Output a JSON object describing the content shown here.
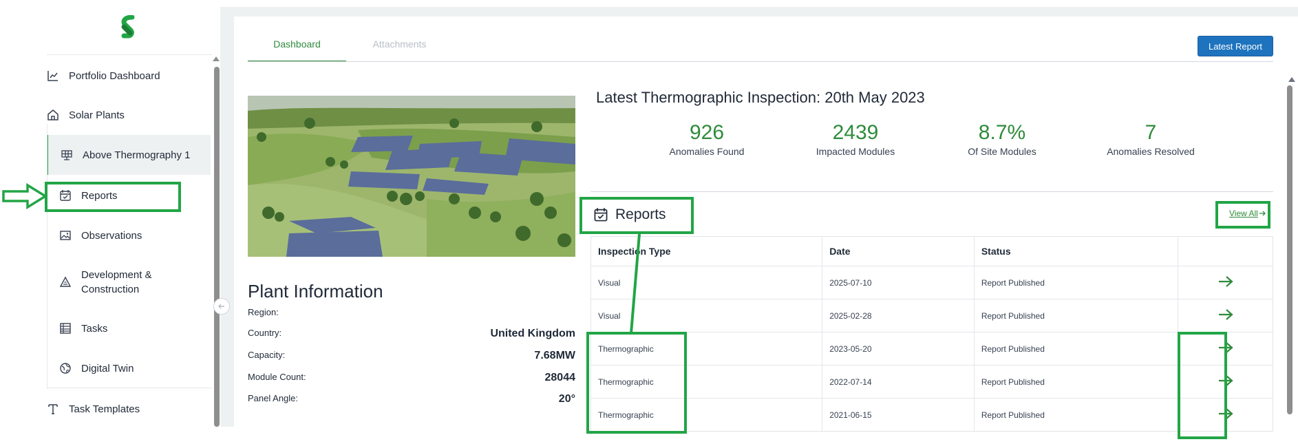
{
  "sidebar": {
    "items": [
      {
        "label": "Portfolio Dashboard",
        "icon": "chart-line-icon"
      },
      {
        "label": "Solar Plants",
        "icon": "home-icon"
      },
      {
        "label": "Above Thermography 1",
        "icon": "solar-panel-icon"
      },
      {
        "label": "Reports",
        "icon": "calendar-check-icon"
      },
      {
        "label": "Observations",
        "icon": "image-icon"
      },
      {
        "label": "Development & Construction",
        "icon": "construction-icon"
      },
      {
        "label": "Tasks",
        "icon": "table-icon"
      },
      {
        "label": "Digital Twin",
        "icon": "globe-icon"
      },
      {
        "label": "Task Templates",
        "icon": "template-icon"
      }
    ]
  },
  "tabs": [
    "Dashboard",
    "Attachments"
  ],
  "latest_report_label": "Latest Report",
  "inspection": {
    "title": "Latest Thermographic Inspection: 20th May 2023",
    "stats": [
      {
        "value": "926",
        "label": "Anomalies Found"
      },
      {
        "value": "2439",
        "label": "Impacted Modules"
      },
      {
        "value": "8.7%",
        "label": "Of Site Modules"
      },
      {
        "value": "7",
        "label": "Anomalies Resolved"
      }
    ]
  },
  "plant_info": {
    "title": "Plant Information",
    "rows": [
      {
        "key": "Region:",
        "value": ""
      },
      {
        "key": "Country:",
        "value": "United Kingdom"
      },
      {
        "key": "Capacity:",
        "value": "7.68MW"
      },
      {
        "key": "Module Count:",
        "value": "28044"
      },
      {
        "key": "Panel Angle:",
        "value": "20°"
      }
    ]
  },
  "reports": {
    "title": "Reports",
    "view_all": "View All",
    "columns": [
      "Inspection Type",
      "Date",
      "Status"
    ],
    "rows": [
      {
        "type": "Visual",
        "date": "2025-07-10",
        "status": "Report Published"
      },
      {
        "type": "Visual",
        "date": "2025-02-28",
        "status": "Report Published"
      },
      {
        "type": "Thermographic",
        "date": "2023-05-20",
        "status": "Report Published"
      },
      {
        "type": "Thermographic",
        "date": "2022-07-14",
        "status": "Report Published"
      },
      {
        "type": "Thermographic",
        "date": "2021-06-15",
        "status": "Report Published"
      }
    ]
  },
  "colors": {
    "accent_green": "#2e8b3a",
    "highlight_green": "#22a546",
    "button_blue": "#1e73be"
  }
}
